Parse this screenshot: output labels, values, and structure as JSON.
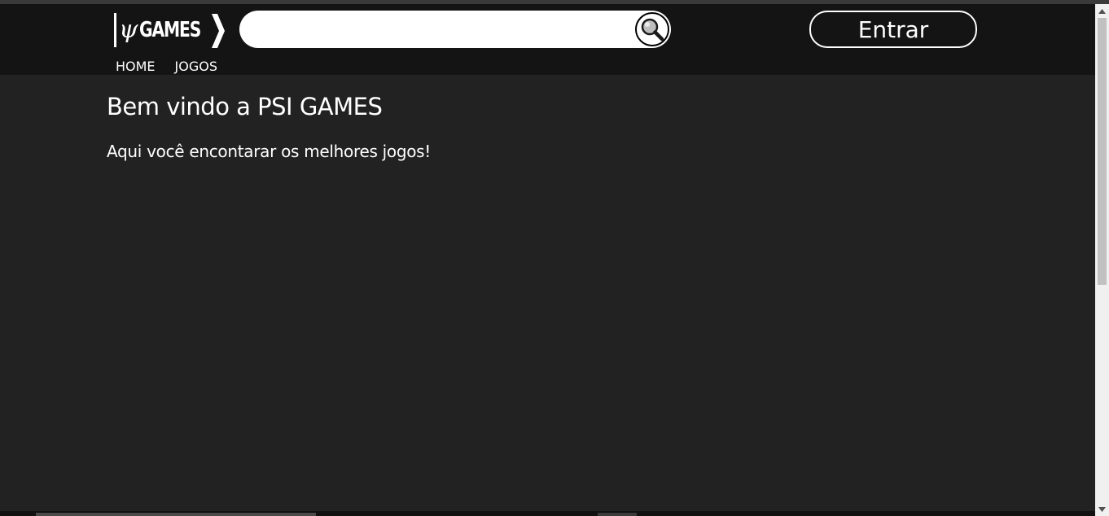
{
  "header": {
    "logo_text": "GAMES",
    "logo_symbol": "ψ",
    "search": {
      "placeholder": "",
      "value": "",
      "icon": "search-icon"
    },
    "login_label": "Entrar"
  },
  "nav": {
    "items": [
      {
        "label": "HOME"
      },
      {
        "label": "JOGOS"
      }
    ]
  },
  "main": {
    "title": "Bem vindo a PSI GAMES",
    "subtitle": "Aqui você encontarar os melhores jogos!"
  },
  "colors": {
    "page_bg": "#222222",
    "header_bg": "#141414",
    "text": "#ffffff"
  }
}
